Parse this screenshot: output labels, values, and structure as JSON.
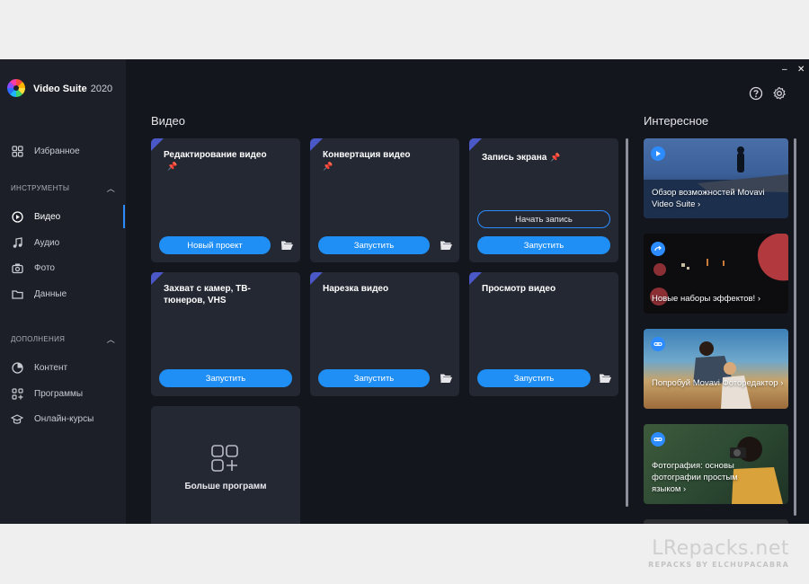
{
  "app": {
    "title": "Video Suite",
    "year": "2020"
  },
  "window": {
    "minimize": "–",
    "close": "✕"
  },
  "sidebar": {
    "favorites": "Избранное",
    "tools_header": "ИНСТРУМЕНТЫ",
    "tools": [
      {
        "label": "Видео",
        "icon": "play-circle-icon",
        "active": true
      },
      {
        "label": "Аудио",
        "icon": "music-note-icon"
      },
      {
        "label": "Фото",
        "icon": "camera-icon"
      },
      {
        "label": "Данные",
        "icon": "folder-icon"
      }
    ],
    "addons_header": "ДОПОЛНЕНИЯ",
    "addons": [
      {
        "label": "Контент",
        "icon": "pie-chart-icon"
      },
      {
        "label": "Программы",
        "icon": "apps-grid-icon"
      },
      {
        "label": "Онлайн-курсы",
        "icon": "graduation-cap-icon"
      }
    ]
  },
  "video": {
    "heading": "Видео",
    "cards": [
      {
        "title": "Редактирование видео",
        "button": "Новый проект",
        "pinned": true,
        "folder": true
      },
      {
        "title": "Конвертация видео",
        "button": "Запустить",
        "pinned": true,
        "folder": true
      },
      {
        "title": "Запись экрана",
        "button": "Запустить",
        "secondary_button": "Начать запись",
        "pinned": true,
        "folder": false
      },
      {
        "title": "Захват с камер, ТВ-тюнеров, VHS",
        "button": "Запустить",
        "folder": false
      },
      {
        "title": "Нарезка видео",
        "button": "Запустить",
        "folder": true
      },
      {
        "title": "Просмотр видео",
        "button": "Запустить",
        "folder": true
      }
    ],
    "more_programs": "Больше программ"
  },
  "interesting": {
    "heading": "Интересное",
    "items": [
      {
        "text": "Обзор возможностей Movavi Video Suite ›",
        "icon": "play-icon"
      },
      {
        "text": "Новые наборы эффектов! ›",
        "icon": "redo-icon"
      },
      {
        "text": "Попробуй Movavi Фоторедактор ›",
        "icon": "link-icon"
      },
      {
        "text": "Фотография: основы фотографии простым языком ›",
        "icon": "link-icon"
      }
    ]
  },
  "watermark": {
    "main": "LRepacks.net",
    "sub": "REPACKS BY ELCHUPACABRA"
  },
  "colors": {
    "accent": "#1f8ff5",
    "card": "#242833",
    "bg": "#14161d",
    "sidebar": "#1c1f28",
    "corner": "#4a58c8"
  }
}
